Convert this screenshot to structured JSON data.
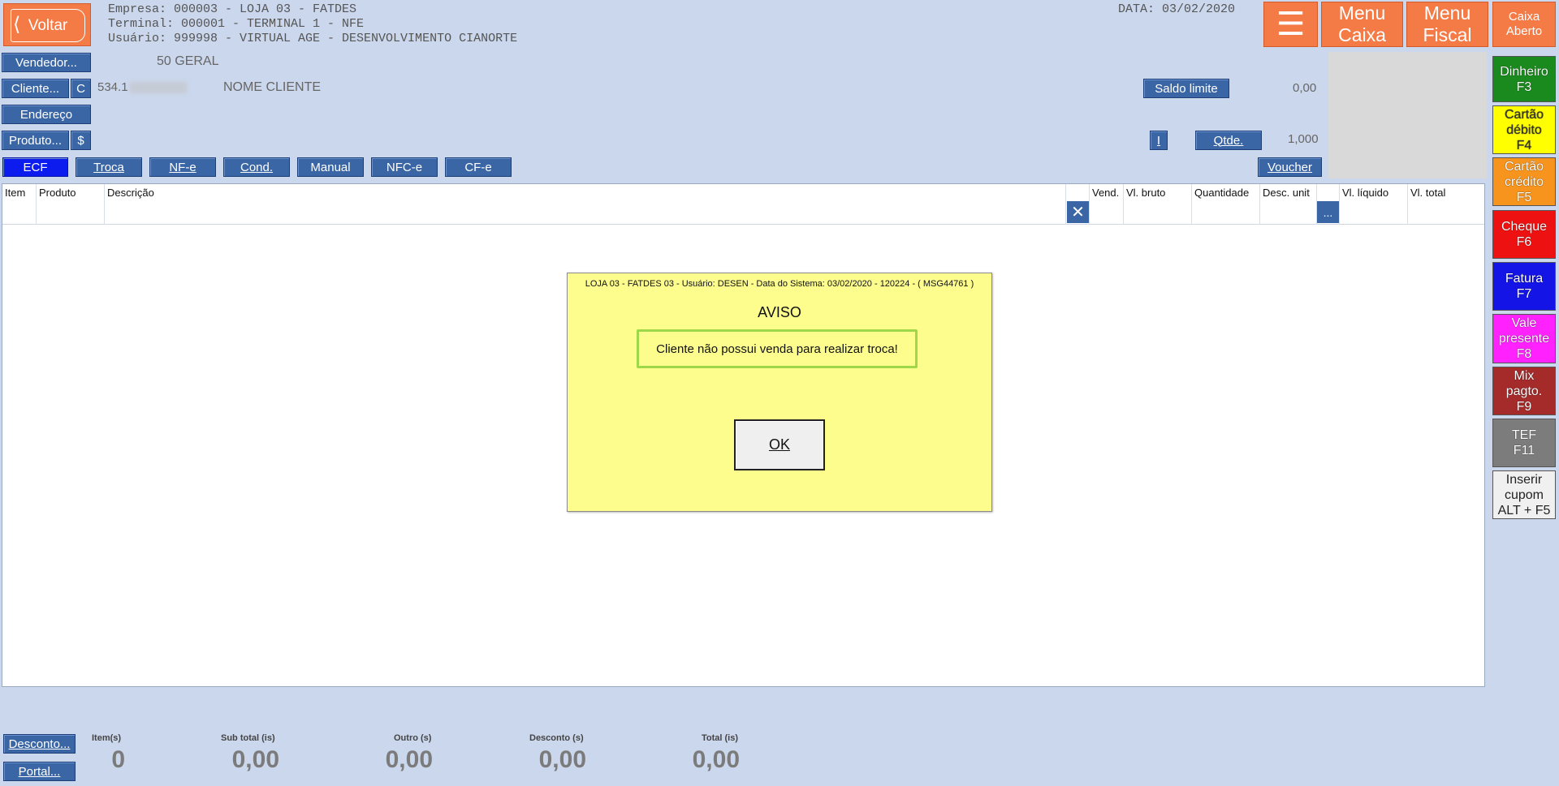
{
  "header": {
    "back_label": "Voltar",
    "empresa": "Empresa: 000003 - LOJA 03 - FATDES",
    "terminal": "Terminal: 000001 - TERMINAL 1 - NFE",
    "usuario": "Usuário: 999998 - VIRTUAL AGE - DESENVOLVIMENTO CIANORTE",
    "data": "DATA: 03/02/2020",
    "hamburger_label": "☰",
    "menu_caixa": "Menu Caixa",
    "menu_fiscal": "Menu Fiscal",
    "caixa_aberto": "Caixa Aberto"
  },
  "sale": {
    "vendedor_button": "Vendedor...",
    "vendedor_value": "50 GERAL",
    "cliente_button": "Cliente...",
    "cliente_c_button": "C",
    "cliente_code": "534.1",
    "cliente_name": "NOME CLIENTE",
    "endereco_button": "Endereço",
    "produto_button": "Produto...",
    "produto_dollar_button": "$",
    "saldo_limite_button": "Saldo limite",
    "saldo_value": "0,00",
    "info_button": "I",
    "qtde_button": "Qtde.",
    "qtde_value": "1,000",
    "voucher_button": "Voucher"
  },
  "modes": [
    "ECF",
    "Troca",
    "NF-e",
    "Cond.",
    "Manual",
    "NFC-e",
    "CF-e"
  ],
  "grid": {
    "columns": [
      "Item",
      "Produto",
      "Descrição",
      "",
      "Vend.",
      "Vl. bruto",
      "Quantidade",
      "Desc. unit",
      "",
      "Vl. líquido",
      "Vl. total"
    ],
    "clear_icon": "✕",
    "more_button": "..."
  },
  "dialog": {
    "header": "LOJA 03 - FATDES 03 - Usuário: DESEN - Data do Sistema: 03/02/2020 - 120224 - ( MSG44761 )",
    "title": "AVISO",
    "message": "Cliente não possui venda para realizar troca!",
    "ok_label": "OK"
  },
  "payments": [
    {
      "label": "Dinheiro\nF3",
      "color": "#1a8a1e"
    },
    {
      "label": "Cartão\ndébito\nF4",
      "color": "#ffff00"
    },
    {
      "label": "Cartão\ncrédito\nF5",
      "color": "#f7941d"
    },
    {
      "label": "Cheque\nF6",
      "color": "#ee1111"
    },
    {
      "label": "Fatura\nF7",
      "color": "#1414e6"
    },
    {
      "label": "Vale\npresente\nF8",
      "color": "#ff22ff"
    },
    {
      "label": "Mix\npagto.\nF9",
      "color": "#a52a2a"
    },
    {
      "label": "TEF\nF11",
      "color": "#7c7c7c"
    },
    {
      "label": "Inserir\ncupom\nALT + F5",
      "color": "#f0f0f0"
    }
  ],
  "footer": {
    "desconto_button": "Desconto...",
    "portal_button": "Portal...",
    "totals": [
      {
        "label": "Item(s)",
        "value": "0"
      },
      {
        "label": "Sub total (is)",
        "value": "0,00"
      },
      {
        "label": "Outro (s)",
        "value": "0,00"
      },
      {
        "label": "Desconto (s)",
        "value": "0,00"
      },
      {
        "label": "Total (is)",
        "value": "0,00"
      }
    ]
  },
  "colors": {
    "background": "#cbd7ec",
    "button_blue": "#3b66a5",
    "button_orange": "#f47a46",
    "dialog_bg": "#fdfd8e",
    "highlight_green": "#9ed84a"
  }
}
